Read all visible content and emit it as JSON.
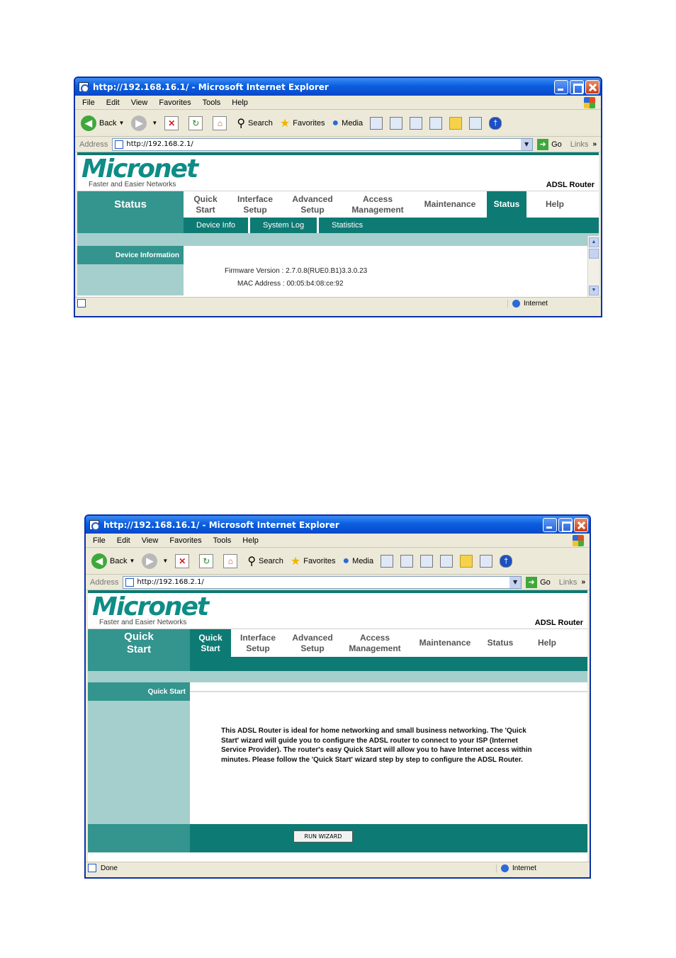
{
  "windows": [
    {
      "title": "http://192.168.16.1/ - Microsoft Internet Explorer",
      "menu": [
        "File",
        "Edit",
        "View",
        "Favorites",
        "Tools",
        "Help"
      ],
      "toolbar": {
        "back": "Back",
        "search": "Search",
        "favorites": "Favorites",
        "media": "Media"
      },
      "address": {
        "label": "Address",
        "url": "http://192.168.2.1/",
        "go": "Go",
        "links": "Links"
      },
      "header": {
        "logo": "Micronet",
        "tagline": "Faster and Easier Networks",
        "product": "ADSL Router"
      },
      "nav": {
        "section": "Status",
        "tabs": [
          {
            "line1": "Quick",
            "line2": "Start"
          },
          {
            "line1": "Interface",
            "line2": "Setup"
          },
          {
            "line1": "Advanced",
            "line2": "Setup"
          },
          {
            "line1": "Access",
            "line2": "Management"
          },
          {
            "line1": "Maintenance",
            "line2": ""
          },
          {
            "line1": "Status",
            "line2": ""
          },
          {
            "line1": "Help",
            "line2": ""
          }
        ],
        "active_tab": "Status",
        "subtabs": [
          "Device Info",
          "System Log",
          "Statistics"
        ]
      },
      "sidebar_heading": "Device Information",
      "info": {
        "firmware": "Firmware Version : 2.7.0.8(RUE0.B1)3.3.0.23",
        "mac": "MAC Address : 00:05:b4:08:ce:92"
      },
      "status": {
        "text": "",
        "zone": "Internet"
      }
    },
    {
      "title": "http://192.168.16.1/ - Microsoft Internet Explorer",
      "menu": [
        "File",
        "Edit",
        "View",
        "Favorites",
        "Tools",
        "Help"
      ],
      "toolbar": {
        "back": "Back",
        "search": "Search",
        "favorites": "Favorites",
        "media": "Media"
      },
      "address": {
        "label": "Address",
        "url": "http://192.168.2.1/",
        "go": "Go",
        "links": "Links"
      },
      "header": {
        "logo": "Micronet",
        "tagline": "Faster and Easier Networks",
        "product": "ADSL Router"
      },
      "nav": {
        "section_line1": "Quick",
        "section_line2": "Start",
        "tabs": [
          {
            "line1": "Quick",
            "line2": "Start"
          },
          {
            "line1": "Interface",
            "line2": "Setup"
          },
          {
            "line1": "Advanced",
            "line2": "Setup"
          },
          {
            "line1": "Access",
            "line2": "Management"
          },
          {
            "line1": "Maintenance",
            "line2": ""
          },
          {
            "line1": "Status",
            "line2": ""
          },
          {
            "line1": "Help",
            "line2": ""
          }
        ],
        "active_tab": "Quick Start"
      },
      "sidebar_heading": "Quick Start",
      "description": "This ADSL Router is ideal for home networking and small business networking. The 'Quick Start' wizard will guide you to configure the ADSL router to connect to your ISP (Internet Service Provider). The router's easy Quick Start will allow you to have Internet access within minutes. Please follow the 'Quick Start' wizard step by step to configure the ADSL Router.",
      "wizard_button": "RUN WIZARD",
      "status": {
        "text": "Done",
        "zone": "Internet"
      }
    }
  ],
  "colors": {
    "teal_dark": "#0e7a74",
    "teal_mid": "#34948e",
    "teal_light": "#a5cfcc",
    "titlebar_blue": "#0a5fe0"
  }
}
